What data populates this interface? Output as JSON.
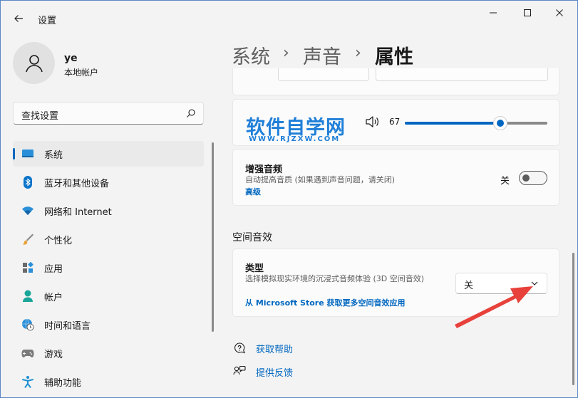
{
  "window": {
    "app_title": "设置"
  },
  "user": {
    "name": "ye",
    "account_type": "本地帐户"
  },
  "search": {
    "placeholder": "查找设置"
  },
  "nav": {
    "items": [
      {
        "label": "系统",
        "icon": "system-icon",
        "active": true
      },
      {
        "label": "蓝牙和其他设备",
        "icon": "bluetooth-icon"
      },
      {
        "label": "网络和 Internet",
        "icon": "wifi-icon"
      },
      {
        "label": "个性化",
        "icon": "brush-icon"
      },
      {
        "label": "应用",
        "icon": "apps-icon"
      },
      {
        "label": "帐户",
        "icon": "person-icon"
      },
      {
        "label": "时间和语言",
        "icon": "globe-clock-icon"
      },
      {
        "label": "游戏",
        "icon": "gamepad-icon"
      },
      {
        "label": "辅助功能",
        "icon": "accessibility-icon"
      }
    ]
  },
  "breadcrumb": {
    "items": [
      "系统",
      "声音",
      "属性"
    ],
    "separator": "›"
  },
  "volume_card": {
    "watermark": "软件自学网",
    "watermark_sub": "WWW.RJZXW.COM",
    "volume_value": "67",
    "volume_level": 0.67
  },
  "enhance_card": {
    "title": "增强音频",
    "description": "自动提高音质 (如果遇到声音问题，请关闭)",
    "link": "高级",
    "toggle_label": "关",
    "toggle_on": false
  },
  "spatial": {
    "section_title": "空间音效",
    "title": "类型",
    "description": "选择模拟现实环境的沉浸式音频体验 (3D 空间音效)",
    "link": "从 Microsoft Store 获取更多空间音效应用",
    "dropdown_value": "关"
  },
  "help": {
    "get_help": "获取帮助",
    "feedback": "提供反馈"
  },
  "colors": {
    "accent": "#0067c0",
    "annotation_arrow": "#e8403a"
  }
}
